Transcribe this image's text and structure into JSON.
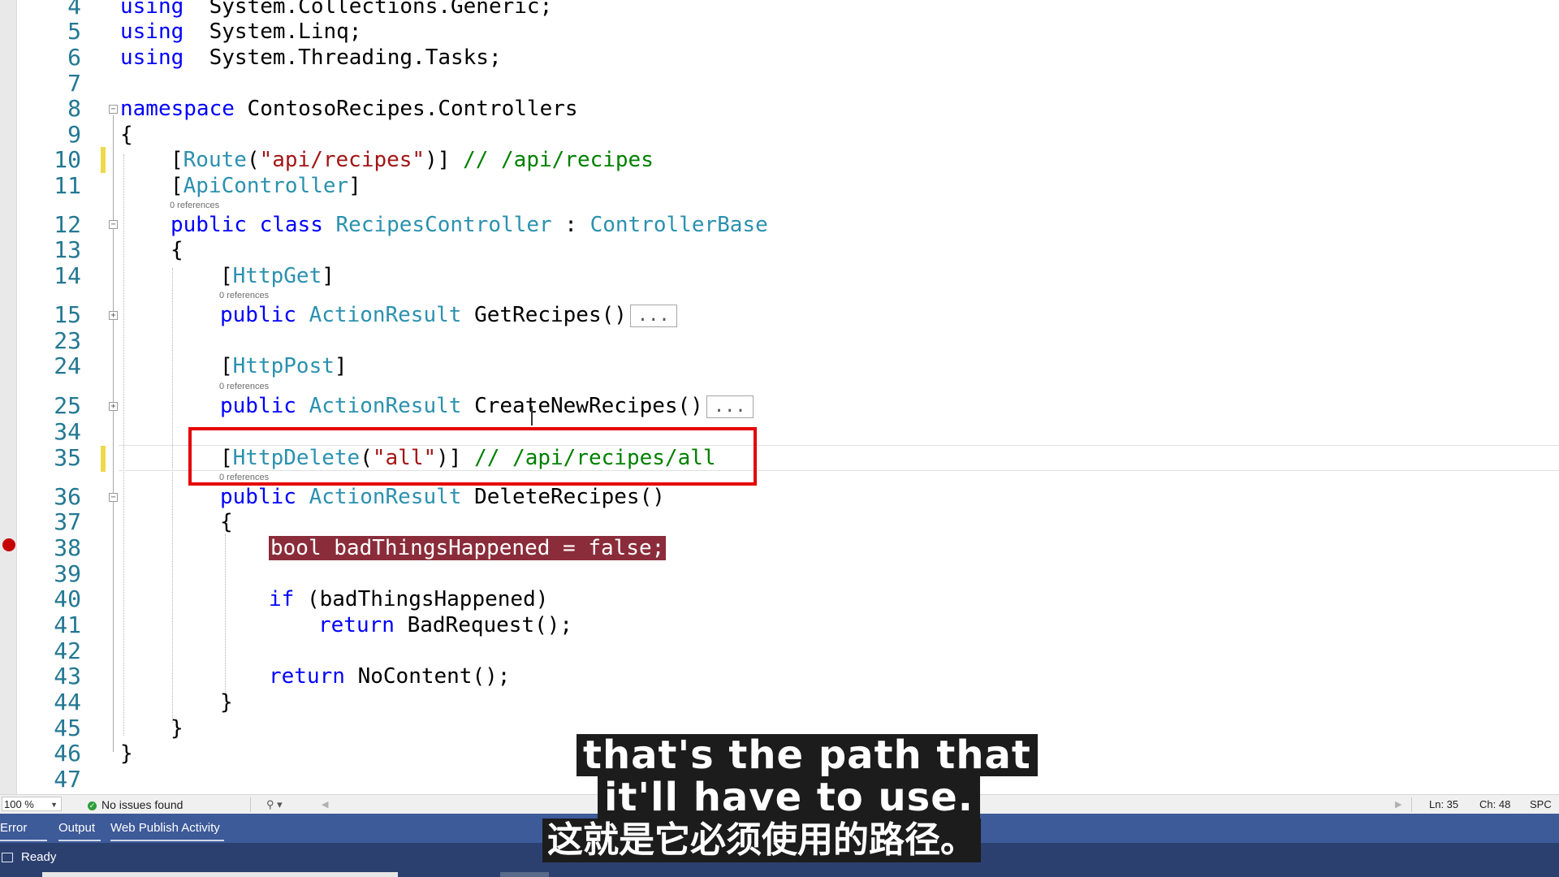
{
  "editor": {
    "lines": [
      {
        "n": "4",
        "tokens": [
          [
            "kw",
            "using"
          ],
          [
            "",
            "  System.Collections.Generic;"
          ]
        ]
      },
      {
        "n": "5",
        "tokens": [
          [
            "kw",
            "using"
          ],
          [
            "",
            "  System.Linq;"
          ]
        ]
      },
      {
        "n": "6",
        "tokens": [
          [
            "kw",
            "using"
          ],
          [
            "",
            "  System.Threading.Tasks;"
          ]
        ]
      },
      {
        "n": "7",
        "tokens": []
      },
      {
        "n": "8",
        "tokens": [
          [
            "kw",
            "namespace"
          ],
          [
            "",
            " ContosoRecipes.Controllers"
          ]
        ]
      },
      {
        "n": "9",
        "tokens": [
          [
            "",
            "{"
          ]
        ]
      },
      {
        "n": "10",
        "tokens": [
          [
            "",
            "["
          ],
          [
            "ty",
            "Route"
          ],
          [
            "",
            "("
          ],
          [
            "st",
            "\"api/recipes\""
          ],
          [
            "",
            ")]"
          ],
          [
            "",
            " "
          ],
          [
            "cm",
            "// /api/recipes"
          ]
        ]
      },
      {
        "n": "11",
        "tokens": [
          [
            "",
            "["
          ],
          [
            "ty",
            "ApiController"
          ],
          [
            "",
            "]"
          ]
        ]
      },
      {
        "n": "12",
        "tokens": [
          [
            "kw",
            "public"
          ],
          [
            "",
            " "
          ],
          [
            "kw",
            "class"
          ],
          [
            "",
            " "
          ],
          [
            "ty",
            "RecipesController"
          ],
          [
            "",
            " : "
          ],
          [
            "ty",
            "ControllerBase"
          ]
        ]
      },
      {
        "n": "13",
        "tokens": [
          [
            "",
            "{"
          ]
        ]
      },
      {
        "n": "14",
        "tokens": [
          [
            "",
            "["
          ],
          [
            "ty",
            "HttpGet"
          ],
          [
            "",
            "]"
          ]
        ]
      },
      {
        "n": "15",
        "tokens": [
          [
            "kw",
            "public"
          ],
          [
            "",
            " "
          ],
          [
            "ty",
            "ActionResult"
          ],
          [
            "",
            " GetRecipes()"
          ]
        ]
      },
      {
        "n": "23",
        "tokens": []
      },
      {
        "n": "24",
        "tokens": [
          [
            "",
            "["
          ],
          [
            "ty",
            "HttpPost"
          ],
          [
            "",
            "]"
          ]
        ]
      },
      {
        "n": "25",
        "tokens": [
          [
            "kw",
            "public"
          ],
          [
            "",
            " "
          ],
          [
            "ty",
            "ActionResult"
          ],
          [
            "",
            " CreateNewRecipes()"
          ]
        ]
      },
      {
        "n": "34",
        "tokens": []
      },
      {
        "n": "35",
        "tokens": [
          [
            "",
            "["
          ],
          [
            "ty",
            "HttpDelete"
          ],
          [
            "",
            "("
          ],
          [
            "st",
            "\"all\""
          ],
          [
            "",
            ")]"
          ],
          [
            "",
            " "
          ],
          [
            "cm",
            "// /api/recipes/all"
          ]
        ]
      },
      {
        "n": "36",
        "tokens": [
          [
            "kw",
            "public"
          ],
          [
            "",
            " "
          ],
          [
            "ty",
            "ActionResult"
          ],
          [
            "",
            " DeleteRecipes()"
          ]
        ]
      },
      {
        "n": "37",
        "tokens": [
          [
            "",
            "{"
          ]
        ]
      },
      {
        "n": "38",
        "tokens": [
          [
            "",
            "bool badThingsHappened = false;"
          ]
        ]
      },
      {
        "n": "39",
        "tokens": []
      },
      {
        "n": "40",
        "tokens": [
          [
            "kw",
            "if"
          ],
          [
            "",
            " (badThingsHappened)"
          ]
        ]
      },
      {
        "n": "41",
        "tokens": [
          [
            "kw",
            "return"
          ],
          [
            "",
            " BadRequest();"
          ]
        ]
      },
      {
        "n": "42",
        "tokens": []
      },
      {
        "n": "43",
        "tokens": [
          [
            "kw",
            "return"
          ],
          [
            "",
            " NoContent();"
          ]
        ]
      },
      {
        "n": "44",
        "tokens": [
          [
            "",
            "}"
          ]
        ]
      },
      {
        "n": "45",
        "tokens": [
          [
            "",
            "}"
          ]
        ]
      },
      {
        "n": "46",
        "tokens": [
          [
            "",
            "}"
          ]
        ]
      },
      {
        "n": "47",
        "tokens": []
      }
    ],
    "references_label": "0 references",
    "collapsed_label": "..."
  },
  "status_strip": {
    "zoom": "100 %",
    "issues": "No issues found",
    "line": "Ln: 35",
    "char": "Ch: 48",
    "mode": "SPC"
  },
  "tool_tabs": [
    "Error List",
    "Output",
    "Web Publish Activity"
  ],
  "status_bar": {
    "text": "Ready"
  },
  "subtitles": {
    "en_line1": "that's the path that",
    "en_line2": "it'll have to use.",
    "zh": "这就是它必须使用的路径。"
  },
  "colors": {
    "keyword": "#0000ff",
    "type": "#2b91af",
    "string": "#a31515",
    "comment": "#008000",
    "breakpoint": "#c50000",
    "highlight_box": "#e60000",
    "status_bar": "#2c4070"
  },
  "icons": [
    "breakpoint-icon",
    "fold-toggle-icon",
    "check-circle-icon",
    "navigation-icon",
    "ready-icon"
  ]
}
